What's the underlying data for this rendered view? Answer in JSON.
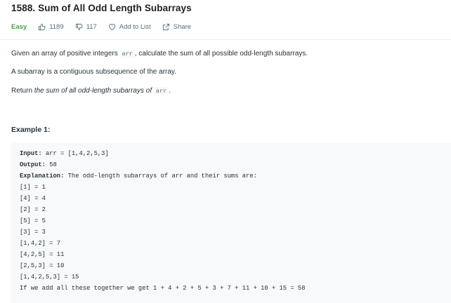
{
  "problem": {
    "title": "1588. Sum of All Odd Length Subarrays",
    "difficulty": "Easy",
    "likes": "1189",
    "dislikes": "117",
    "add_to_list": "Add to List",
    "share": "Share"
  },
  "description": {
    "p1_before": "Given an array of positive integers ",
    "p1_code": "arr",
    "p1_after": ", calculate the sum of all possible odd-length subarrays.",
    "p2": "A subarray is a contiguous subsequence of the array.",
    "p3_before": "Return ",
    "p3_italic": "the sum of all odd-length subarrays of ",
    "p3_code": "arr",
    "p3_after": "."
  },
  "example": {
    "heading": "Example 1:",
    "input_label": "Input:",
    "input_value": " arr = [1,4,2,5,3]",
    "output_label": "Output:",
    "output_value": " 58",
    "explanation_label": "Explanation:",
    "explanation_value": " The odd-length subarrays of arr and their sums are:",
    "lines": [
      "[1] = 1",
      "[4] = 4",
      "[2] = 2",
      "[5] = 5",
      "[3] = 3",
      "[1,4,2] = 7",
      "[4,2,5] = 11",
      "[2,5,3] = 10",
      "[1,4,2,5,3] = 15",
      "If we add all these together we get 1 + 4 + 2 + 5 + 3 + 7 + 11 + 10 + 15 = 58"
    ]
  },
  "colors": {
    "easy": "#43a047",
    "code_bg": "#f7f9fa",
    "text": "#263238",
    "muted": "#546e7a"
  }
}
